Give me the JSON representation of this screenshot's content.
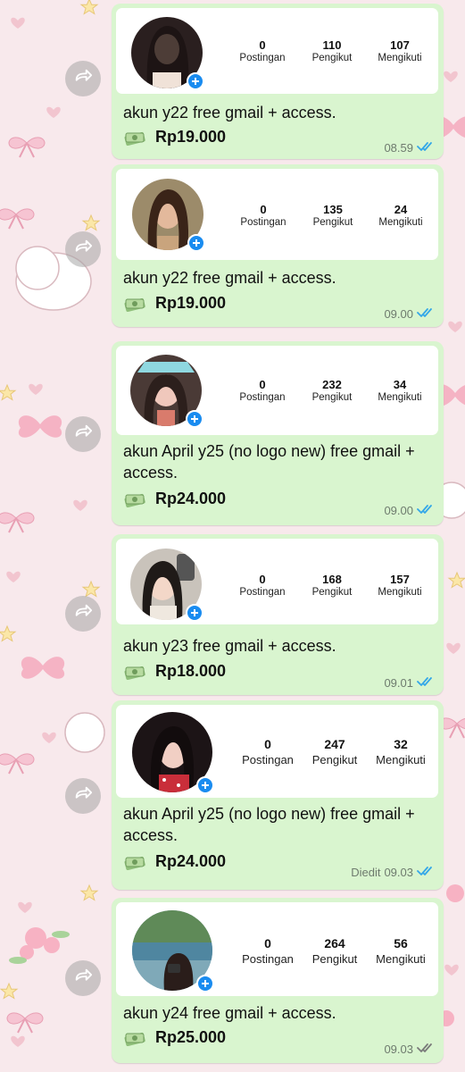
{
  "colors": {
    "bubble": "#d9f5cf",
    "card": "#ffffff",
    "accent_blue": "#1a8cf0",
    "read_ticks": "#34a7e8",
    "sent_ticks": "#7a7a7a"
  },
  "icons": {
    "forward": "forward-icon",
    "money": "money-icon",
    "plus": "plus-icon",
    "double_check": "double-check-icon"
  },
  "stat_labels": {
    "posts": "Postingan",
    "followers": "Pengikut",
    "following": "Mengikuti"
  },
  "messages": [
    {
      "posts": "0",
      "followers": "110",
      "following": "107",
      "text": "akun y22 free gmail + access.",
      "price": "Rp19.000",
      "edited": "",
      "time": "08.59",
      "status": "read"
    },
    {
      "posts": "0",
      "followers": "135",
      "following": "24",
      "text": "akun y22 free gmail + access.",
      "price": "Rp19.000",
      "edited": "",
      "time": "09.00",
      "status": "read"
    },
    {
      "posts": "0",
      "followers": "232",
      "following": "34",
      "text": "akun April y25 (no logo new) free gmail + access.",
      "price": "Rp24.000",
      "edited": "",
      "time": "09.00",
      "status": "read"
    },
    {
      "posts": "0",
      "followers": "168",
      "following": "157",
      "text": "akun y23 free gmail + access.",
      "price": "Rp18.000",
      "edited": "",
      "time": "09.01",
      "status": "read"
    },
    {
      "posts": "0",
      "followers": "247",
      "following": "32",
      "text": "akun April y25 (no logo new) free gmail + access.",
      "price": "Rp24.000",
      "edited": "Diedit",
      "time": "09.03",
      "status": "read"
    },
    {
      "posts": "0",
      "followers": "264",
      "following": "56",
      "text": "akun y24 free gmail + access.",
      "price": "Rp25.000",
      "edited": "",
      "time": "09.03",
      "status": "sent"
    }
  ]
}
